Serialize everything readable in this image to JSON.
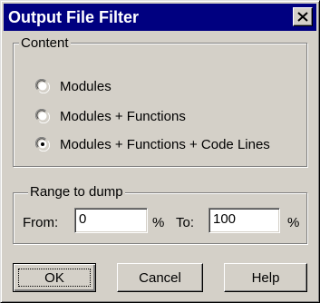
{
  "window": {
    "title": "Output File Filter",
    "close_glyph": "close-icon",
    "title_bar_color": "#000080",
    "face_color": "#d4d0c8"
  },
  "content_group": {
    "label": "Content",
    "options": [
      {
        "label": "Modules",
        "selected": false
      },
      {
        "label": "Modules + Functions",
        "selected": false
      },
      {
        "label": "Modules + Functions + Code Lines",
        "selected": true
      }
    ]
  },
  "range_group": {
    "label": "Range to dump",
    "from_label": "From:",
    "from_value": "0",
    "from_unit": "%",
    "to_label": "To:",
    "to_value": "100",
    "to_unit": "%"
  },
  "buttons": {
    "ok": "OK",
    "cancel": "Cancel",
    "help": "Help"
  }
}
